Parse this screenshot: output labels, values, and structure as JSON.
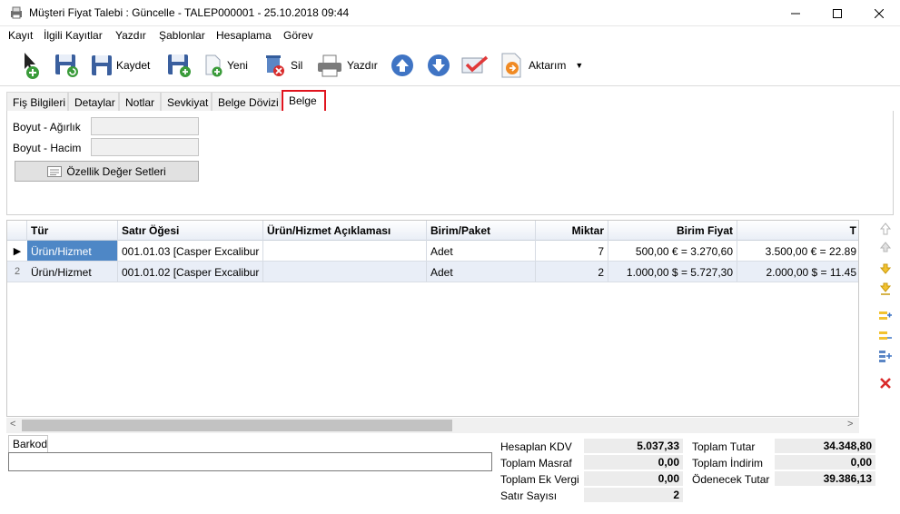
{
  "window": {
    "title": "Müşteri Fiyat Talebi : Güncelle - TALEP000001 - 25.10.2018 09:44"
  },
  "menu": [
    "Kayıt",
    "İlgili Kayıtlar",
    "Yazdır",
    "Şablonlar",
    "Hesaplama",
    "Görev"
  ],
  "toolbar": {
    "save_label": "Kaydet",
    "new_label": "Yeni",
    "delete_label": "Sil",
    "print_label": "Yazdır",
    "export_label": "Aktarım"
  },
  "tabs": [
    "Fiş Bilgileri",
    "Detaylar",
    "Notlar",
    "Sevkiyat",
    "Belge Dövizi",
    "Belge"
  ],
  "active_tab": "Belge",
  "form": {
    "weight_label": "Boyut - Ağırlık",
    "weight_value": "",
    "volume_label": "Boyut - Hacim",
    "volume_value": "",
    "property_button": "Özellik Değer Setleri"
  },
  "grid": {
    "columns": [
      "Tür",
      "Satır Öğesi",
      "Ürün/Hizmet Açıklaması",
      "Birim/Paket",
      "Miktar",
      "Birim Fiyat",
      "T"
    ],
    "rows": [
      {
        "indicator": "▶",
        "type": "Ürün/Hizmet",
        "item": "001.01.03 [Casper Excalibur ...",
        "desc": "",
        "unit": "Adet",
        "qty": "7",
        "unit_price": "500,00 € = 3.270,60",
        "total": "3.500,00 € = 22.89"
      },
      {
        "indicator": "2",
        "type": "Ürün/Hizmet",
        "item": "001.01.02 [Casper Excalibur ...",
        "desc": "",
        "unit": "Adet",
        "qty": "2",
        "unit_price": "1.000,00 $ = 5.727,30",
        "total": "2.000,00 $ = 11.45"
      }
    ]
  },
  "barkod": {
    "tab_label": "Barkod",
    "value": ""
  },
  "summary": {
    "kdv_label": "Hesaplan KDV",
    "kdv_value": "5.037,33",
    "masraf_label": "Toplam Masraf",
    "masraf_value": "0,00",
    "ekvergi_label": "Toplam Ek Vergi",
    "ekvergi_value": "0,00",
    "satir_label": "Satır Sayısı",
    "satir_value": "2",
    "tutar_label": "Toplam Tutar",
    "tutar_value": "34.348,80",
    "indirim_label": "Toplam İndirim",
    "indirim_value": "0,00",
    "odenecek_label": "Ödenecek Tutar",
    "odenecek_value": "39.386,13"
  },
  "colors": {
    "active_tab_border": "#e0141e",
    "selected_cell": "#4e87c6",
    "row_alt": "#e9eef7"
  }
}
